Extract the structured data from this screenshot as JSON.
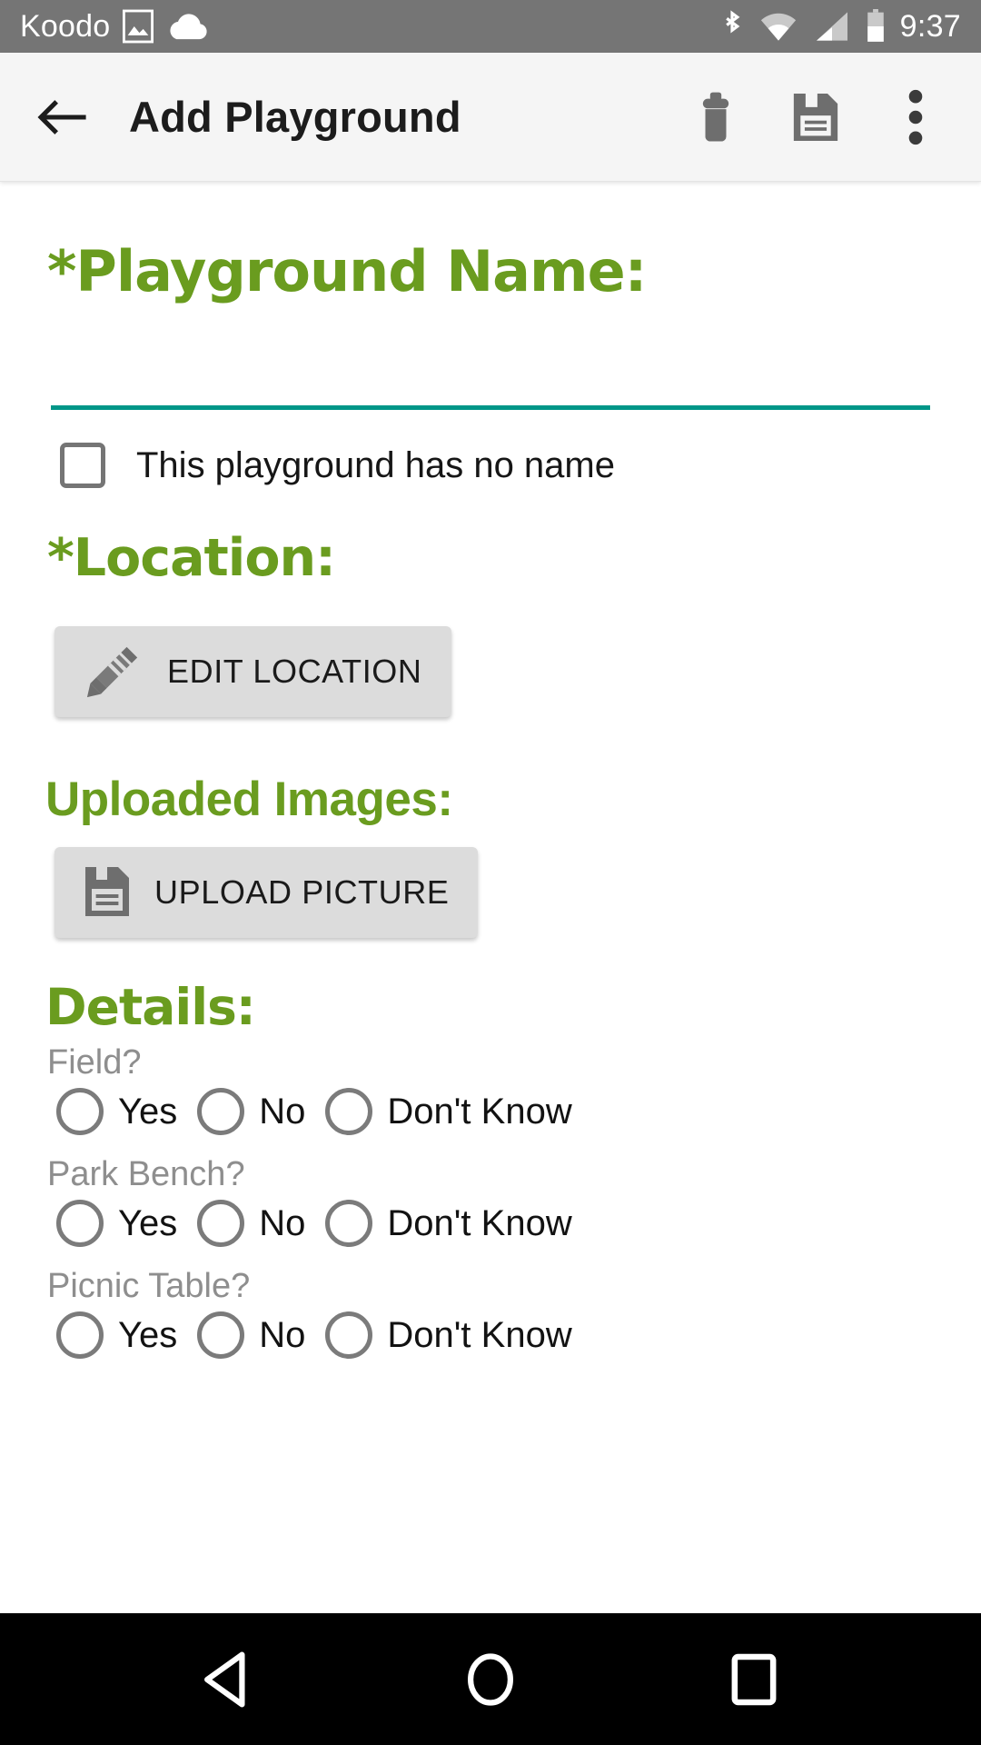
{
  "status_bar": {
    "carrier": "Koodo",
    "time": "9:37",
    "icons_left": [
      "gallery-icon",
      "cloud-icon"
    ],
    "icons_right": [
      "bluetooth-icon",
      "wifi-icon",
      "cellular-signal-icon",
      "battery-icon"
    ],
    "background": "#757575"
  },
  "app_bar": {
    "back_icon": "back-arrow-icon",
    "title": "Add Playground",
    "actions": [
      {
        "name": "delete-icon",
        "label": "Delete"
      },
      {
        "name": "save-icon",
        "label": "Save"
      },
      {
        "name": "overflow-menu-icon",
        "label": "More options"
      }
    ],
    "background": "#f5f5f5"
  },
  "form": {
    "accent_green": "#6a9c1f",
    "underline_teal": "#009688",
    "playground_name": {
      "label": "*Playground Name:",
      "value": "",
      "placeholder": ""
    },
    "no_name_checkbox": {
      "label": "This playground has no name",
      "checked": false
    },
    "location": {
      "label": "*Location:",
      "button_label": "EDIT LOCATION",
      "button_icon": "pencil-icon"
    },
    "uploaded_images": {
      "label": "Uploaded Images:",
      "button_label": "UPLOAD PICTURE",
      "button_icon": "floppy-disk-icon"
    },
    "details": {
      "label": "Details:",
      "options": [
        "Yes",
        "No",
        "Don't Know"
      ],
      "questions": [
        {
          "text": "Field?",
          "selected": null
        },
        {
          "text": "Park Bench?",
          "selected": null
        },
        {
          "text": "Picnic Table?",
          "selected": null
        }
      ]
    }
  },
  "nav_bar": {
    "buttons": [
      {
        "name": "nav-back-icon",
        "label": "Back"
      },
      {
        "name": "nav-home-icon",
        "label": "Home"
      },
      {
        "name": "nav-recents-icon",
        "label": "Recents"
      }
    ],
    "background": "#000000"
  }
}
